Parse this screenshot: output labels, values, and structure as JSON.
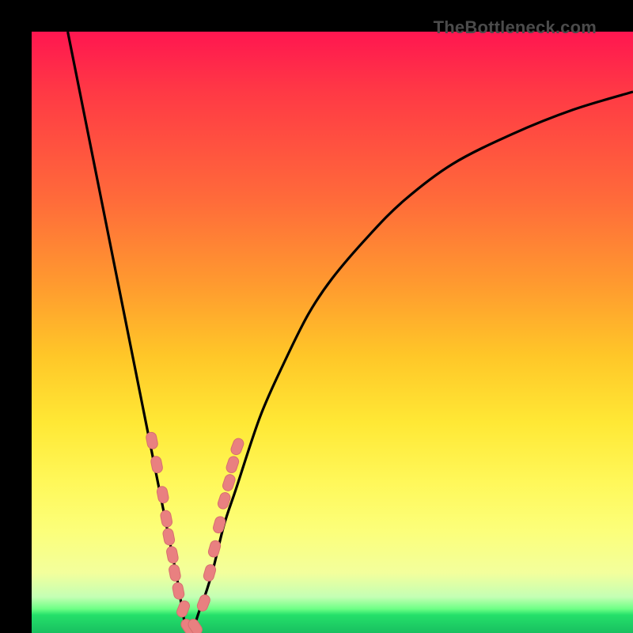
{
  "watermark": "TheBottleneck.com",
  "colors": {
    "curve": "#000000",
    "marker_fill": "#e98080",
    "marker_stroke": "#d76f6f",
    "frame": "#000000"
  },
  "chart_data": {
    "type": "line",
    "title": "",
    "xlabel": "",
    "ylabel": "",
    "xlim": [
      0,
      100
    ],
    "ylim": [
      0,
      100
    ],
    "note": "V-shaped bottleneck curve. y is percent bottleneck (100 = severe, 0 = optimal). x is relative component balance. Minimum sits near x≈26.",
    "series": [
      {
        "name": "bottleneck-curve",
        "x": [
          6,
          8,
          10,
          12,
          14,
          16,
          18,
          20,
          22,
          24,
          26,
          28,
          30,
          32,
          34,
          38,
          42,
          46,
          50,
          56,
          62,
          70,
          80,
          90,
          100
        ],
        "y": [
          100,
          90,
          80,
          70,
          60,
          50,
          40,
          30,
          20,
          10,
          0,
          4,
          10,
          18,
          24,
          36,
          45,
          53,
          59,
          66,
          72,
          78,
          83,
          87,
          90
        ]
      }
    ],
    "markers": {
      "name": "highlighted-points",
      "note": "salmon capsule markers clustered along both branches near the minimum",
      "points": [
        {
          "x": 20.0,
          "y": 32
        },
        {
          "x": 20.8,
          "y": 28
        },
        {
          "x": 21.8,
          "y": 23
        },
        {
          "x": 22.4,
          "y": 19
        },
        {
          "x": 22.8,
          "y": 16
        },
        {
          "x": 23.4,
          "y": 13
        },
        {
          "x": 23.8,
          "y": 10
        },
        {
          "x": 24.4,
          "y": 7
        },
        {
          "x": 25.2,
          "y": 4
        },
        {
          "x": 26.0,
          "y": 1
        },
        {
          "x": 27.2,
          "y": 1
        },
        {
          "x": 28.6,
          "y": 5
        },
        {
          "x": 29.6,
          "y": 10
        },
        {
          "x": 30.4,
          "y": 14
        },
        {
          "x": 31.2,
          "y": 18
        },
        {
          "x": 32.0,
          "y": 22
        },
        {
          "x": 32.8,
          "y": 25
        },
        {
          "x": 33.4,
          "y": 28
        },
        {
          "x": 34.2,
          "y": 31
        }
      ]
    }
  }
}
